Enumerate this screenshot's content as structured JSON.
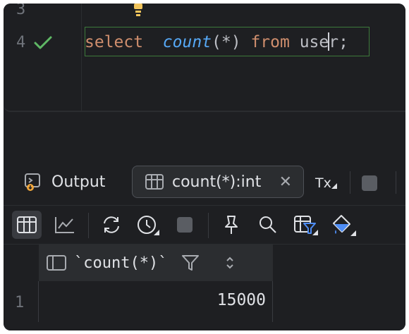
{
  "editor": {
    "line_numbers": [
      "3",
      "4"
    ],
    "code": {
      "kw_select": "select",
      "fn_count": "count",
      "args": "(*)",
      "kw_from": "from",
      "table_a": "use",
      "table_b": "r",
      "semicolon": ";"
    }
  },
  "tabs": {
    "output_label": "Output",
    "result_label": "count(*):int",
    "close_glyph": "✕",
    "tx_label": "Tx"
  },
  "grid": {
    "column_header": "`count(*)`",
    "rows": [
      {
        "num": "1",
        "value": "15000"
      }
    ]
  },
  "colors": {
    "background": "#1e1f22",
    "keyword": "#cf8e6d",
    "function": "#56a8f5",
    "success": "#5fb865",
    "selected_tab_border": "#4e5157"
  }
}
